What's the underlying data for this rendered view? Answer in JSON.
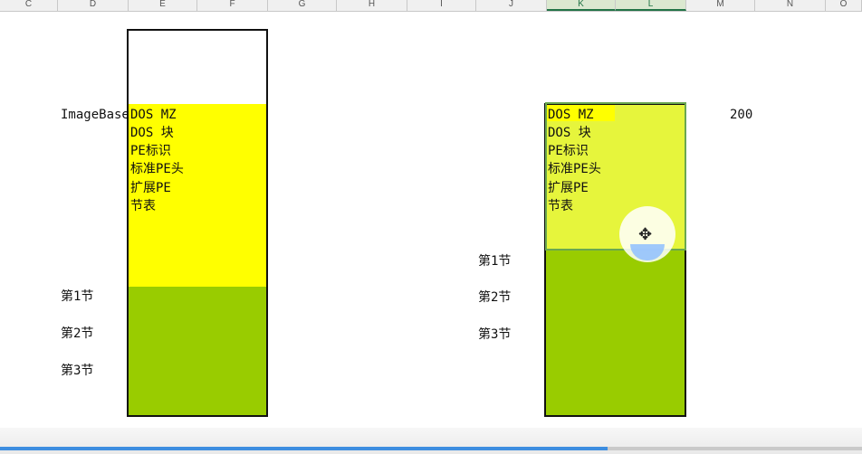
{
  "columns": [
    "C",
    "D",
    "E",
    "F",
    "G",
    "H",
    "I",
    "J",
    "K",
    "L",
    "M",
    "N",
    "O"
  ],
  "left_diagram": {
    "image_base_label": "ImageBase",
    "header_items": [
      "DOS MZ",
      "DOS 块",
      "PE标识",
      "标准PE头",
      "扩展PE",
      "节表"
    ],
    "sections": [
      "第1节",
      "第2节",
      "第3节"
    ]
  },
  "right_diagram": {
    "header_items": [
      "DOS MZ",
      "DOS 块",
      "PE标识",
      "标准PE头",
      "扩展PE",
      "节表"
    ],
    "sections": [
      "第1节",
      "第2节",
      "第3节"
    ],
    "value": "200"
  },
  "cursor": {
    "icon": "move-cursor-icon",
    "glyph": "✥"
  },
  "video_progress": {
    "fraction": 0.705
  },
  "colors": {
    "yellow": "#ffff00",
    "green": "#99cc00",
    "light_yellow": "#e6f53c",
    "progress": "#3d8de0"
  }
}
